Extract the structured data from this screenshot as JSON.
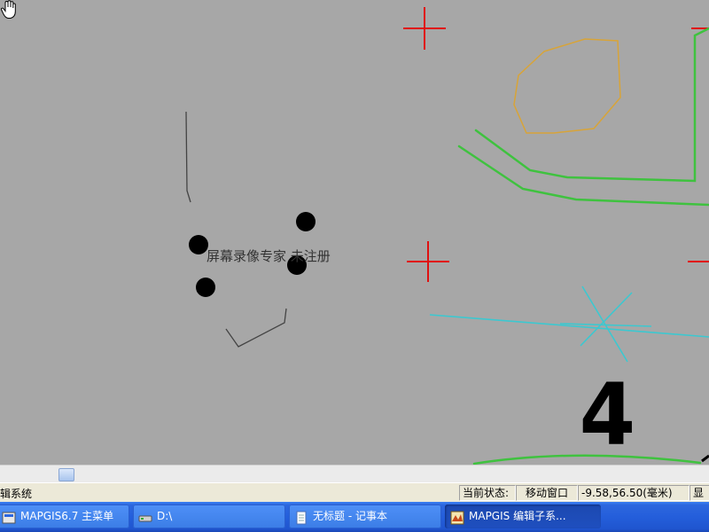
{
  "canvas": {
    "watermark_text": "屏幕录像专家 未注册",
    "label_number": "4",
    "colors": {
      "background": "#a7a7a7",
      "cross_marker": "#e01010",
      "polygon_outline": "#d8a438",
      "green_lines": "#3fc23f",
      "cyan_lines": "#3cc8d0",
      "dark_lines": "#444444",
      "points": "#000000"
    }
  },
  "status_bar": {
    "app_name": "辑系统",
    "state_label": "当前状态:",
    "state_value": "移动窗口",
    "coordinates": "-9.58,56.50(毫米)",
    "trailing": "显"
  },
  "taskbar": {
    "items": [
      {
        "label": "MAPGIS6.7 主菜单",
        "icon": "app-icon"
      },
      {
        "label": "D:\\",
        "icon": "drive-icon"
      },
      {
        "label": "无标题 - 记事本",
        "icon": "notepad-icon"
      },
      {
        "label": "MAPGIS 编辑子系...",
        "icon": "mapgis-icon"
      }
    ]
  }
}
